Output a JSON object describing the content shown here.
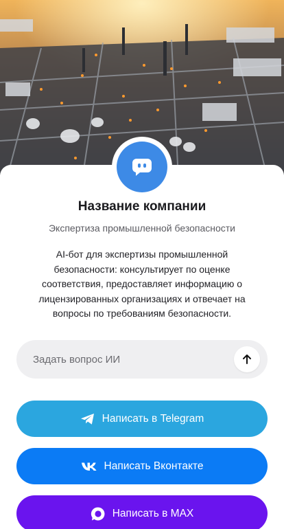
{
  "hero": {
    "image": "industrial-plant-aerial-photo"
  },
  "company": {
    "name": "Название компании",
    "subtitle": "Экспертиза промышленной безопасности",
    "description": "AI-бот для экспертизы промышленной безопасности: консультирует по оценке соответствия, предоставляет информацию о лицензированных организациях и отвечает на вопросы по требованиям безопасности."
  },
  "ask": {
    "placeholder": "Задать вопрос ИИ",
    "value": ""
  },
  "buttons": {
    "telegram": {
      "label": "Написать в Telegram",
      "icon": "telegram-icon"
    },
    "vk": {
      "label": "Написать Вконтакте",
      "icon": "vk-icon"
    },
    "max": {
      "label": "Написать в MAX",
      "icon": "max-icon"
    }
  },
  "colors": {
    "avatar": "#3d8ae6",
    "telegram": "#2ba6df",
    "vk": "#0b7bf5",
    "max": "#6a14ee"
  }
}
